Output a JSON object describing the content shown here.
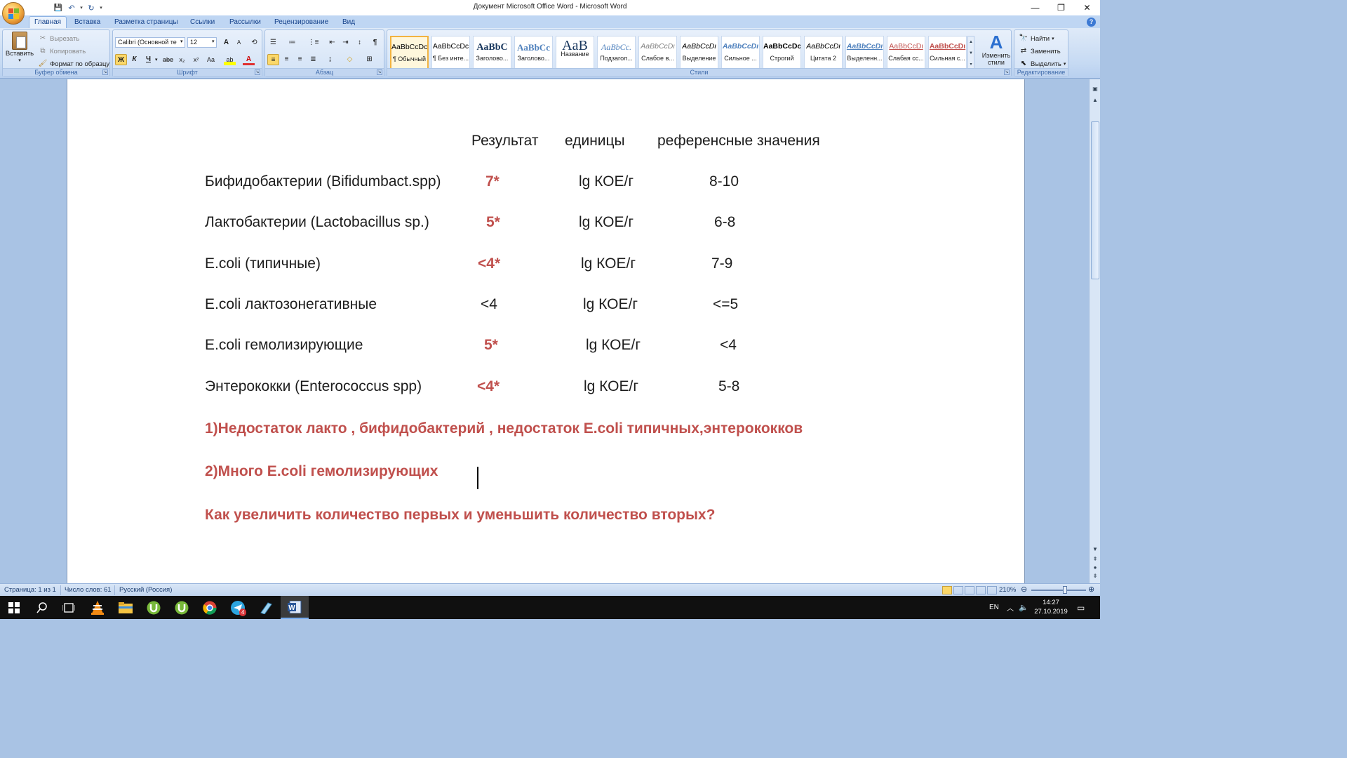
{
  "window": {
    "title": "Документ Microsoft Office Word - Microsoft Word",
    "min": "—",
    "restore": "❐",
    "close": "✕"
  },
  "qat": {
    "save": "💾",
    "undo": "↶",
    "redo": "↻",
    "more": "▾"
  },
  "tabs": [
    "Главная",
    "Вставка",
    "Разметка страницы",
    "Ссылки",
    "Рассылки",
    "Рецензирование",
    "Вид"
  ],
  "ribbon": {
    "clipboard": {
      "label": "Буфер обмена",
      "paste": "Вставить",
      "cut": "Вырезать",
      "copy": "Копировать",
      "format_painter": "Формат по образцу"
    },
    "font": {
      "label": "Шрифт",
      "font_name": "Calibri (Основной те",
      "font_size": "12",
      "grow": "A",
      "shrink": "A",
      "clear": "⟲",
      "bold": "Ж",
      "italic": "К",
      "underline": "Ч",
      "strike": "abe",
      "subscript": "x₂",
      "superscript": "x²",
      "case": "Aa",
      "highlight": "ab",
      "font_color": "A"
    },
    "paragraph": {
      "label": "Абзац",
      "show_marks": "¶"
    },
    "styles": {
      "label": "Стили",
      "items": [
        {
          "sample": "AaBbCcDc",
          "name": "¶ Обычный"
        },
        {
          "sample": "AaBbCcDc",
          "name": "¶ Без инте..."
        },
        {
          "sample": "AaBbC",
          "name": "Заголово..."
        },
        {
          "sample": "AaBbCc",
          "name": "Заголово..."
        },
        {
          "sample": "AaB",
          "name": "Название"
        },
        {
          "sample": "AaBbCc.",
          "name": "Подзагол..."
        },
        {
          "sample": "AaBbCcDι",
          "name": "Слабое в..."
        },
        {
          "sample": "AaBbCcDι",
          "name": "Выделение"
        },
        {
          "sample": "AaBbCcDι",
          "name": "Сильное ..."
        },
        {
          "sample": "AaBbCcDc",
          "name": "Строгий"
        },
        {
          "sample": "AaBbCcDι",
          "name": "Цитата 2"
        },
        {
          "sample": "AaBbCcDι",
          "name": "Выделенн..."
        },
        {
          "sample": "AaBbCcDι",
          "name": "Слабая сс..."
        },
        {
          "sample": "AaBbCcDι",
          "name": "Сильная с..."
        }
      ],
      "change": "Изменить стили"
    },
    "editing": {
      "label": "Редактирование",
      "find": "Найти",
      "replace": "Заменить",
      "select": "Выделить"
    }
  },
  "document": {
    "header": {
      "result": "Результат",
      "units": "единицы",
      "reference": "референсные значения"
    },
    "rows": [
      {
        "name": "Бифидобактерии (Bifidumbact.spp)",
        "result": "7*",
        "units": "lg КОЕ/г",
        "ref": "8-10"
      },
      {
        "name": "Лактобактерии (Lactobacillus sp.)",
        "result": "5*",
        "units": "lg КОЕ/г",
        "ref": "6-8"
      },
      {
        "name": "E.coli (типичные)",
        "result": "<4*",
        "units": "lg КОЕ/г",
        "ref": "7-9"
      },
      {
        "name": "E.coli лактозонегативные",
        "result": "<4",
        "units": "lg КОЕ/г",
        "ref": "<=5"
      },
      {
        "name": "E.coli гемолизирующие",
        "result": "5*",
        "units": "lg КОЕ/г",
        "ref": "<4"
      },
      {
        "name": "Энтерококки (Enterococcus spp)",
        "result": "<4*",
        "units": "lg КОЕ/г",
        "ref": "5-8"
      }
    ],
    "note1": "1)Недостаток лакто , бифидобактерий , недостаток E.coli типичных,энтерококков",
    "note2": "2)Много E.coli гемолизирующих",
    "question": "Как увеличить количество первых и уменьшить количество вторых?"
  },
  "status": {
    "page": "Страница: 1 из 1",
    "words": "Число слов: 61",
    "language": "Русский (Россия)",
    "zoom": "210%"
  },
  "taskbar": {
    "lang": "EN",
    "time": "14:27",
    "date": "27.10.2019",
    "telegram_badge": "4"
  },
  "colors": {
    "accent_red": "#c0504d",
    "ribbon": "#c6daf3",
    "doc_bg": "#a9c3e4"
  }
}
